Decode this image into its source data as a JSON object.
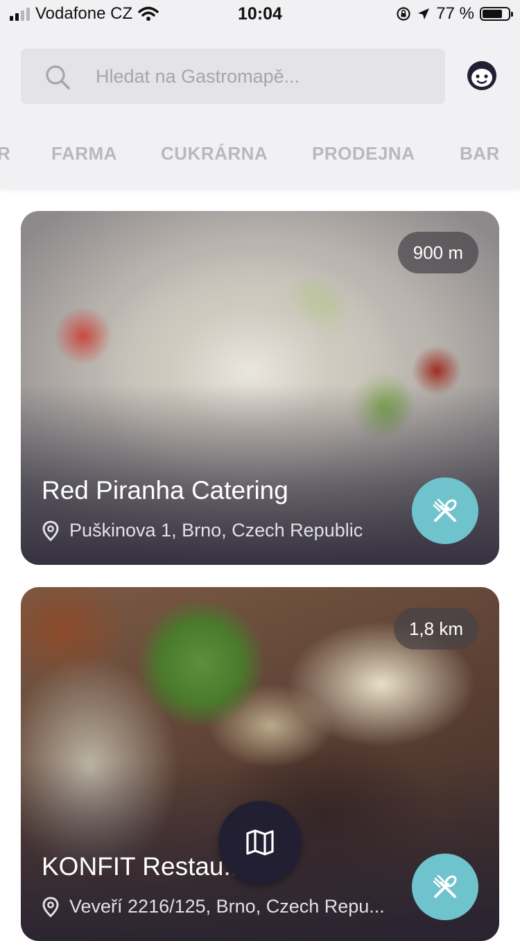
{
  "status_bar": {
    "carrier": "Vodafone CZ",
    "time": "10:04",
    "battery_percent": "77 %",
    "battery_level": 0.77
  },
  "search": {
    "placeholder": "Hledat na Gastromapě..."
  },
  "categories": [
    {
      "label": "R"
    },
    {
      "label": "FARMA"
    },
    {
      "label": "CUKRÁRNA"
    },
    {
      "label": "PRODEJNA"
    },
    {
      "label": "BAR"
    }
  ],
  "places": [
    {
      "name": "Red Piranha Catering",
      "address": "Puškinova 1, Brno, Czech Republic",
      "distance": "900 m",
      "type_icon": "fork-knife-icon"
    },
    {
      "name": "KONFIT Restau...",
      "address": "Veveří 2216/125, Brno, Czech Repu...",
      "distance": "1,8 km",
      "type_icon": "fork-knife-icon"
    }
  ],
  "colors": {
    "accent_teal": "#6ec3cc",
    "dark_button": "#221f33",
    "header_bg": "#f1f1f3",
    "category_inactive": "#b8b8be"
  },
  "map_button": {
    "icon": "map-icon"
  }
}
